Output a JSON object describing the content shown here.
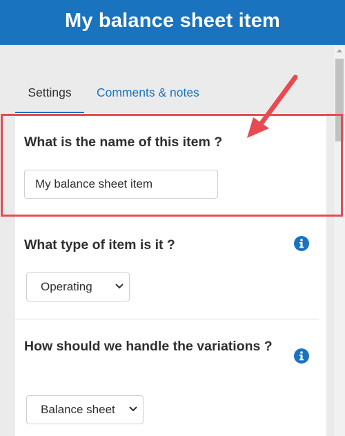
{
  "header": {
    "title": "My balance sheet item"
  },
  "tabs": [
    {
      "label": "Settings",
      "active": true
    },
    {
      "label": "Comments & notes",
      "active": false
    }
  ],
  "form": {
    "name_question": "What is the name of this item ?",
    "name_value": "My balance sheet item",
    "type_question": "What type of item is it ?",
    "type_selected": "Operating",
    "variations_question": "How should we handle the variations ?",
    "variations_selected": "Balance sheet"
  },
  "colors": {
    "header_bg": "#1a73bf",
    "accent": "#1a73bf",
    "highlight": "#e84a52"
  },
  "icons": [
    "info-icon",
    "chevron-down-icon",
    "annotation-arrow"
  ]
}
